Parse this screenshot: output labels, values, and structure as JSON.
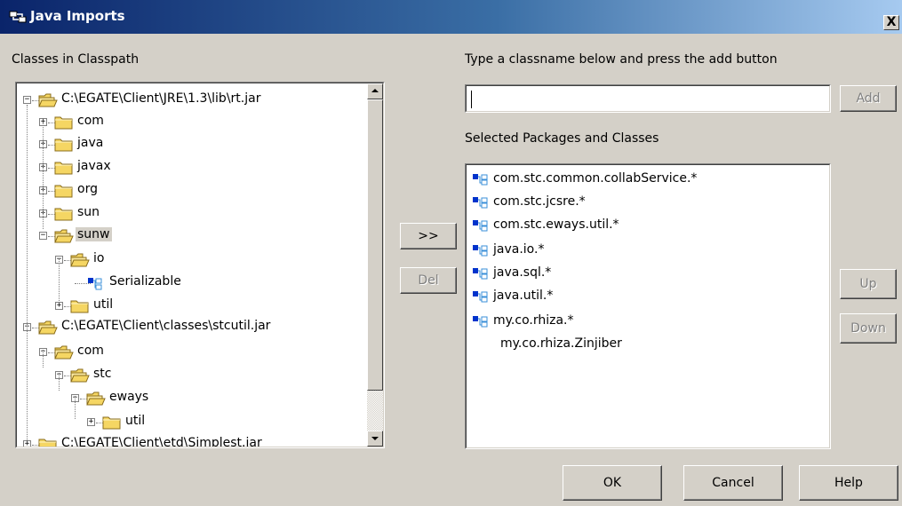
{
  "window": {
    "title": "Java Imports",
    "close_glyph": "X",
    "title_icon": "java-imports-icon"
  },
  "left_panel": {
    "label": "Classes in Classpath"
  },
  "tree": [
    {
      "label": "C:\\EGATE\\Client\\JRE\\1.3\\lib\\rt.jar",
      "expander": "−",
      "icon": "folder-open-icon"
    },
    {
      "label": "com",
      "expander": "+",
      "icon": "folder-icon"
    },
    {
      "label": "java",
      "expander": "+",
      "icon": "folder-icon"
    },
    {
      "label": "javax",
      "expander": "+",
      "icon": "folder-icon"
    },
    {
      "label": "org",
      "expander": "+",
      "icon": "folder-icon"
    },
    {
      "label": "sun",
      "expander": "+",
      "icon": "folder-icon"
    },
    {
      "label": "sunw",
      "expander": "−",
      "icon": "folder-open-icon",
      "selected": true
    },
    {
      "label": "io",
      "expander": "−",
      "icon": "folder-open-icon"
    },
    {
      "label": "Serializable",
      "expander": "",
      "icon": "class-icon"
    },
    {
      "label": "util",
      "expander": "+",
      "icon": "folder-icon"
    },
    {
      "label": "C:\\EGATE\\Client\\classes\\stcutil.jar",
      "expander": "−",
      "icon": "folder-open-icon"
    },
    {
      "label": "com",
      "expander": "−",
      "icon": "folder-open-icon"
    },
    {
      "label": "stc",
      "expander": "−",
      "icon": "folder-open-icon"
    },
    {
      "label": "eways",
      "expander": "−",
      "icon": "folder-open-icon"
    },
    {
      "label": "util",
      "expander": "+",
      "icon": "folder-icon"
    },
    {
      "label": "C:\\EGATE\\Client\\etd\\Simplest.jar",
      "expander": "+",
      "icon": "folder-icon"
    }
  ],
  "middle": {
    "add_label": ">>",
    "del_label": "Del"
  },
  "right_panel": {
    "instruction": "Type a classname below and press the add button",
    "classname_value": "",
    "add_button": "Add",
    "selected_label": "Selected Packages and Classes",
    "up_button": "Up",
    "down_button": "Down"
  },
  "selected_items": [
    {
      "text": "com.stc.common.collabService.*",
      "icon": "package-icon"
    },
    {
      "text": "com.stc.jcsre.*",
      "icon": "package-icon"
    },
    {
      "text": "com.stc.eways.util.*",
      "icon": "package-icon"
    },
    {
      "text": "java.io.*",
      "icon": "package-icon"
    },
    {
      "text": "java.sql.*",
      "icon": "package-icon"
    },
    {
      "text": "java.util.*",
      "icon": "package-icon"
    },
    {
      "text": "my.co.rhiza.*",
      "icon": "package-icon"
    },
    {
      "text": "my.co.rhiza.Zinjiber",
      "icon": ""
    }
  ],
  "footer": {
    "ok": "OK",
    "cancel": "Cancel",
    "help": "Help"
  },
  "colors": {
    "title_gradient_start": "#0a246a",
    "title_gradient_end": "#a6caf0",
    "dialog_face": "#d4d0c8",
    "folder_yellow": "#f5d663",
    "package_blue": "#0033cc"
  }
}
